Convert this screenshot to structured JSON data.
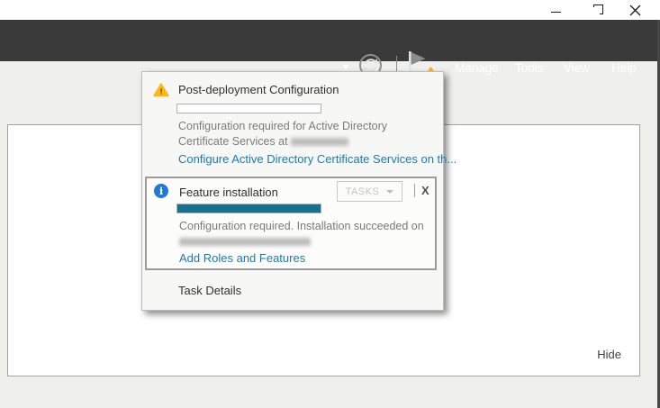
{
  "toolbar": {
    "menus": [
      {
        "label": "Manage"
      },
      {
        "label": "Tools"
      },
      {
        "label": "View"
      },
      {
        "label": "Help"
      }
    ]
  },
  "flyout": {
    "post_deployment": {
      "title": "Post-deployment Configuration",
      "progress_percent": 0,
      "message_line1": "Configuration required for Active Directory",
      "message_line2": "Certificate Services at",
      "server_name_redacted": true,
      "link_label": "Configure Active Directory Certificate Services on th..."
    },
    "feature_installation": {
      "title": "Feature installation",
      "tasks_button_label": "TASKS",
      "close_glyph": "X",
      "progress_percent": 100,
      "message_line1": "Configuration required. Installation succeeded on",
      "server_name_redacted": true,
      "link_label": "Add Roles and Features"
    },
    "task_details_label": "Task Details"
  },
  "page": {
    "hide_label": "Hide"
  },
  "colors": {
    "toolbar_bg": "#3a3a3a",
    "accent_link": "#1a7cad",
    "progress_teal": "#17708f",
    "warning_amber": "#fdb813",
    "info_blue": "#1e7ad4"
  }
}
